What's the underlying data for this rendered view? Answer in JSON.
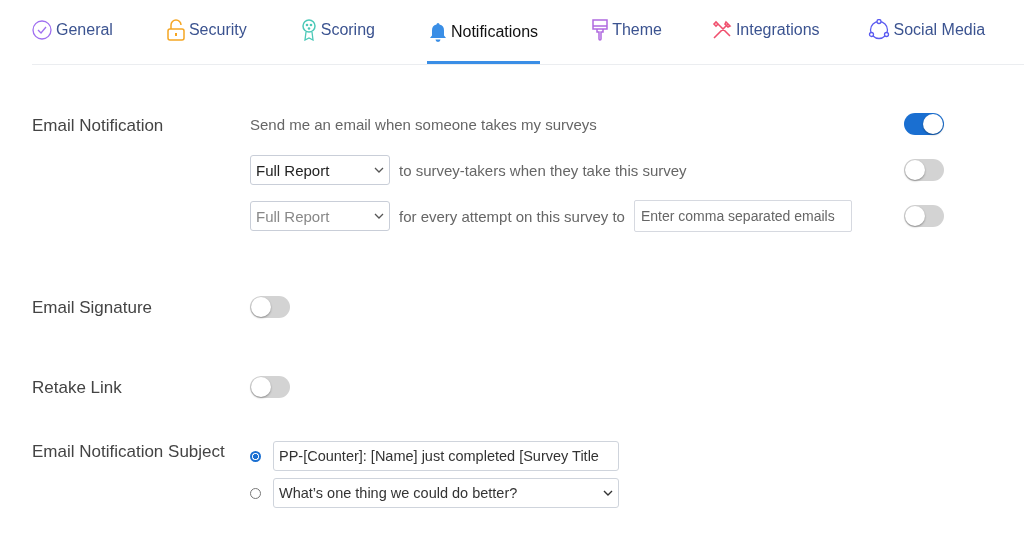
{
  "tabs": [
    {
      "label": "General",
      "selected": false
    },
    {
      "label": "Security",
      "selected": false
    },
    {
      "label": "Scoring",
      "selected": false
    },
    {
      "label": "Notifications",
      "selected": true
    },
    {
      "label": "Theme",
      "selected": false
    },
    {
      "label": "Integrations",
      "selected": false
    },
    {
      "label": "Social Media",
      "selected": false
    }
  ],
  "email_notification": {
    "label": "Email Notification",
    "rows": [
      {
        "kind": "text",
        "text": "Send me an email when someone takes my surveys",
        "on": true
      },
      {
        "kind": "select",
        "select": {
          "value": "Full Report",
          "disabled": false
        },
        "text": "to survey-takers when they take this survey",
        "on": false
      },
      {
        "kind": "select_email",
        "select": {
          "value": "Full Report",
          "disabled": true
        },
        "text": "for every attempt on this survey to",
        "email_field": {
          "placeholder": "Enter comma separated emails"
        },
        "on": false
      }
    ]
  },
  "settings": [
    {
      "label": "Email Signature",
      "on": false
    },
    {
      "label": "Retake Link",
      "on": false
    }
  ],
  "subject": {
    "label": "Email Notification Subject",
    "options": [
      {
        "kind": "input",
        "value": "PP-[Counter]: [Name] just completed [Survey Title",
        "selected": true
      },
      {
        "kind": "select",
        "value": "What’s one thing we could do better?",
        "selected": false
      }
    ]
  }
}
